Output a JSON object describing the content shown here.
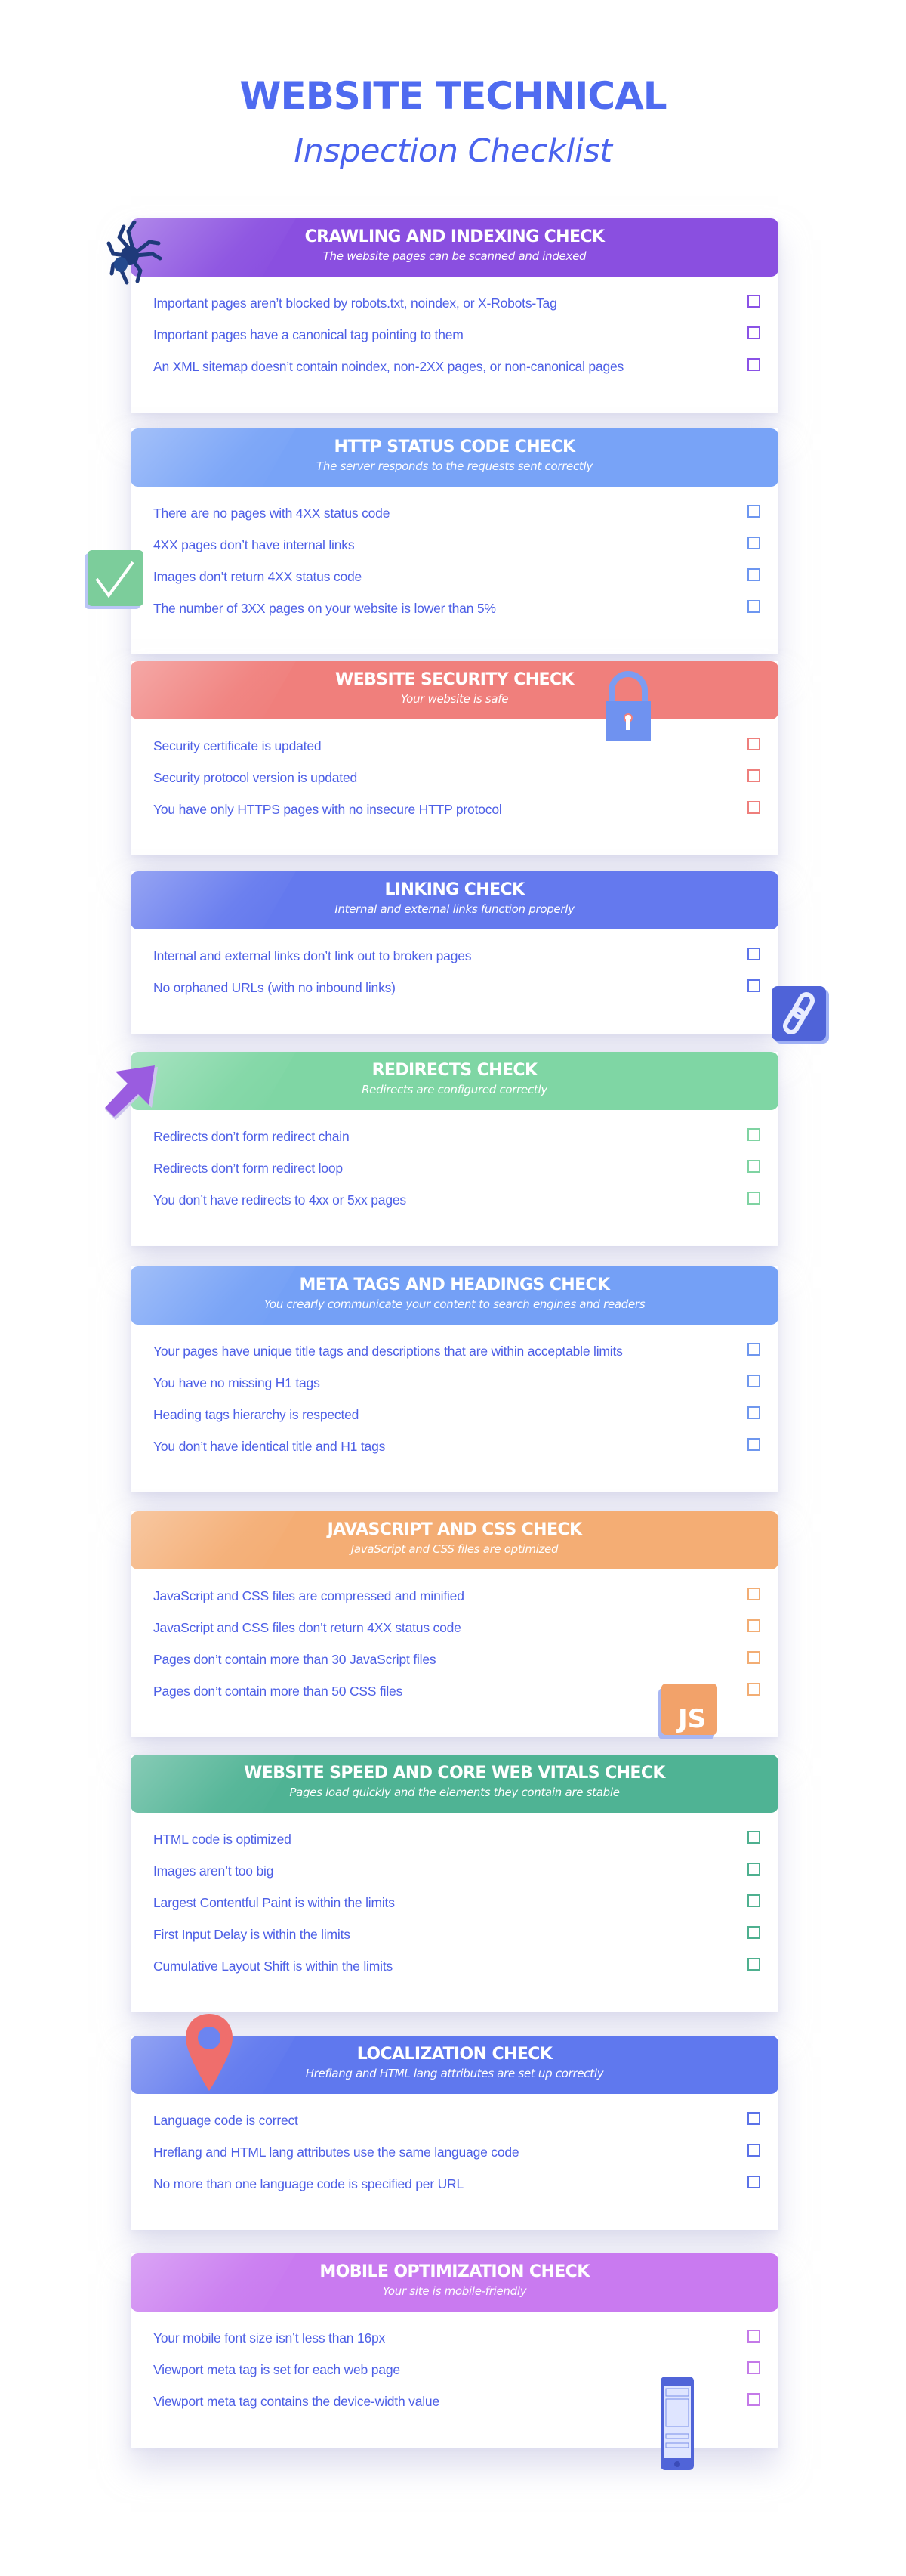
{
  "title": {
    "line1": "WEBSITE TECHNICAL",
    "line2": "Inspection Checklist"
  },
  "sections": [
    {
      "title": "CRAWLING AND INDEXING CHECK",
      "subtitle": "The website pages can be scanned and indexed",
      "color": "#8a4fe0",
      "checkbox_color": "#8a52e6",
      "icon": "spider-icon",
      "items": [
        {
          "label": "Important pages aren’t blocked by robots.txt, noindex, or X-Robots-Tag",
          "checked": false
        },
        {
          "label": "Important pages have a canonical tag pointing to them",
          "checked": false
        },
        {
          "label": "An XML sitemap doesn’t contain noindex, non-2XX pages, or non-canonical pages",
          "checked": false
        }
      ]
    },
    {
      "title": "HTTP STATUS CODE CHECK",
      "subtitle": "The server responds to the requests sent correctly",
      "color": "#78a3f7",
      "checkbox_color": "#6d96f0",
      "icon": "checkmark-icon",
      "items": [
        {
          "label": "There are no pages with 4XX status code",
          "checked": false
        },
        {
          "label": "4XX pages don’t have internal links",
          "checked": false
        },
        {
          "label": "Images don’t return 4XX status code",
          "checked": false
        },
        {
          "label": "The number of 3XX pages on your website is lower than 5%",
          "checked": false
        }
      ]
    },
    {
      "title": "WEBSITE SECURITY CHECK",
      "subtitle": "Your website is safe",
      "color": "#f07f7c",
      "checkbox_color": "#ee7f7c",
      "icon": "padlock-icon",
      "items": [
        {
          "label": "Security certificate is updated",
          "checked": false
        },
        {
          "label": "Security protocol version is updated",
          "checked": false
        },
        {
          "label": "You have only HTTPS pages with no insecure HTTP protocol",
          "checked": false
        }
      ]
    },
    {
      "title": "LINKING CHECK",
      "subtitle": "Internal and external links function properly",
      "color": "#6479ee",
      "checkbox_color": "#5d74ea",
      "icon": "link-icon",
      "items": [
        {
          "label": "Internal and external links don’t link out to broken pages",
          "checked": false
        },
        {
          "label": "No orphaned URLs (with no inbound links)",
          "checked": false
        }
      ]
    },
    {
      "title": "REDIRECTS CHECK",
      "subtitle": "Redirects are configured correctly",
      "color": "#7fd6a4",
      "checkbox_color": "#7fd3a2",
      "icon": "cursor-arrow-icon",
      "items": [
        {
          "label": "Redirects don’t form redirect chain",
          "checked": false
        },
        {
          "label": "Redirects don’t form redirect loop",
          "checked": false
        },
        {
          "label": "You don’t have redirects to 4xx or 5xx pages",
          "checked": false
        }
      ]
    },
    {
      "title": "META TAGS AND HEADINGS CHECK",
      "subtitle": "You crearly communicate your content to search engines and readers",
      "color": "#74a0f6",
      "checkbox_color": "#6f97ee",
      "icon": "",
      "items": [
        {
          "label": "Your pages have unique title tags and descriptions that are within acceptable limits",
          "checked": false
        },
        {
          "label": "You have no missing H1 tags",
          "checked": false
        },
        {
          "label": "Heading tags hierarchy is respected",
          "checked": false
        },
        {
          "label": "You don’t have identical title and H1 tags",
          "checked": false
        }
      ]
    },
    {
      "title": "JAVASCRIPT AND CSS CHECK",
      "subtitle": "JavaScript and CSS files are optimized",
      "color": "#f4ad74",
      "checkbox_color": "#f2ad74",
      "icon": "js-icon",
      "icon_text": "JS",
      "items": [
        {
          "label": "JavaScript and CSS files are compressed and minified",
          "checked": false
        },
        {
          "label": "JavaScript and CSS files don’t return 4XX status code",
          "checked": false
        },
        {
          "label": "Pages don’t contain more than 30 JavaScript files",
          "checked": false
        },
        {
          "label": "Pages don’t contain more than 50 CSS files",
          "checked": false
        }
      ]
    },
    {
      "title": "WEBSITE SPEED AND CORE WEB VITALS CHECK",
      "subtitle": "Pages load quickly and the elements they contain are stable",
      "color": "#4fb394",
      "checkbox_color": "#4eb08f",
      "icon": "",
      "items": [
        {
          "label": "HTML code is optimized",
          "checked": false
        },
        {
          "label": "Images aren’t too big",
          "checked": false
        },
        {
          "label": "Largest Contentful Paint is within the limits",
          "checked": false
        },
        {
          "label": "First Input Delay is within the limits",
          "checked": false
        },
        {
          "label": "Cumulative Layout Shift is within the limits",
          "checked": false
        }
      ]
    },
    {
      "title": "LOCALIZATION CHECK",
      "subtitle": "Hreflang and HTML lang attributes are set up correctly",
      "color": "#5f78ee",
      "checkbox_color": "#5b72e8",
      "icon": "map-pin-icon",
      "items": [
        {
          "label": "Language code is correct",
          "checked": false
        },
        {
          "label": "Hreflang and HTML lang attributes use the same language code",
          "checked": false
        },
        {
          "label": "No more than one language code is specified per URL",
          "checked": false
        }
      ]
    },
    {
      "title": "MOBILE OPTIMIZATION CHECK",
      "subtitle": "Your site is mobile-friendly",
      "color": "#c97af0",
      "checkbox_color": "#c47ae8",
      "icon": "smartphone-icon",
      "items": [
        {
          "label": "Your mobile font size isn’t less than 16px",
          "checked": false
        },
        {
          "label": "Viewport meta tag is set for each web page",
          "checked": false
        },
        {
          "label": "Viewport meta tag contains the device-width value",
          "checked": false
        }
      ]
    }
  ]
}
